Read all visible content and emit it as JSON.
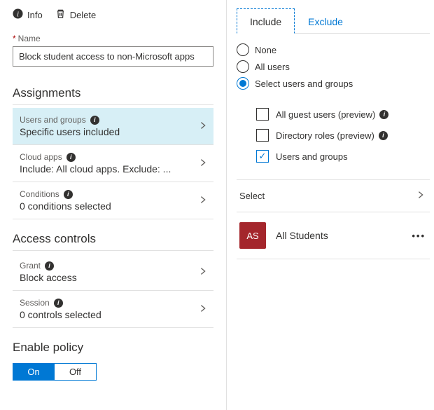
{
  "toolbar": {
    "info_label": "Info",
    "delete_label": "Delete"
  },
  "name_field": {
    "label": "Name",
    "value": "Block student access to non-Microsoft apps"
  },
  "assignments": {
    "heading": "Assignments",
    "rows": [
      {
        "title": "Users and groups",
        "sub": "Specific users included",
        "active": true
      },
      {
        "title": "Cloud apps",
        "sub": "Include: All cloud apps. Exclude: ...",
        "active": false
      },
      {
        "title": "Conditions",
        "sub": "0 conditions selected",
        "active": false
      }
    ]
  },
  "access_controls": {
    "heading": "Access controls",
    "rows": [
      {
        "title": "Grant",
        "sub": "Block access"
      },
      {
        "title": "Session",
        "sub": "0 controls selected"
      }
    ]
  },
  "enable_policy": {
    "heading": "Enable policy",
    "on_label": "On",
    "off_label": "Off",
    "value": "On"
  },
  "right": {
    "tabs": {
      "include": "Include",
      "exclude": "Exclude",
      "active": "Include"
    },
    "radios": {
      "none": "None",
      "all": "All users",
      "select": "Select users and groups",
      "value": "select"
    },
    "checks": {
      "guest": {
        "label": "All guest users (preview)",
        "checked": false
      },
      "roles": {
        "label": "Directory roles (preview)",
        "checked": false
      },
      "users": {
        "label": "Users and groups",
        "checked": true
      }
    },
    "select_label": "Select",
    "group": {
      "initials": "AS",
      "name": "All Students"
    }
  }
}
